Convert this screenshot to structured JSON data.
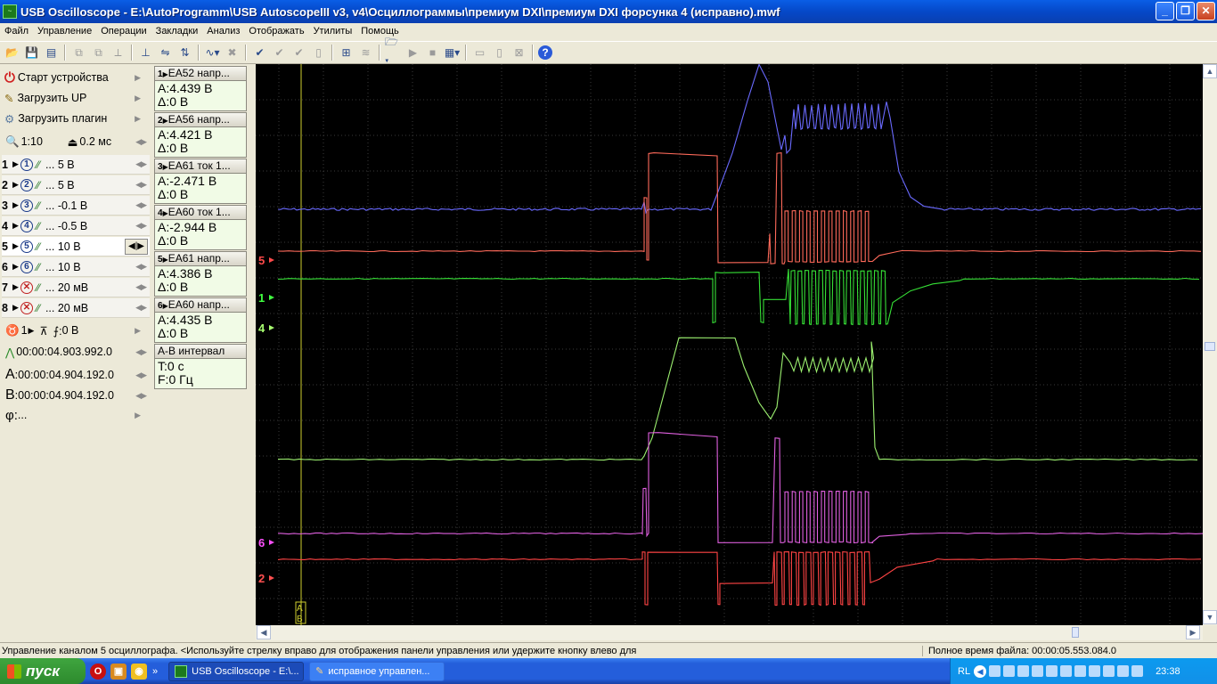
{
  "window": {
    "title": "USB Oscilloscope - E:\\AutoProgramm\\USB AutoscopeIII v3, v4\\Осциллограммы\\премиум DXI\\премиум DXI форсунка 4 (исправно).mwf"
  },
  "menu": [
    "Файл",
    "Управление",
    "Операции",
    "Закладки",
    "Анализ",
    "Отображать",
    "Утилиты",
    "Помощь"
  ],
  "toolbar_icons": [
    "open-icon",
    "save-icon",
    "print-icon",
    "copy-icon",
    "paste-icon",
    "measure-icon",
    "cursor-icon",
    "zoom-icon",
    "scale-icon",
    "filter-icon",
    "delete-icon",
    "check-icon",
    "check2-icon",
    "check3-icon",
    "page-icon",
    "grid-icon",
    "wave-icon",
    "folder-icon",
    "play-icon",
    "stop-icon",
    "display-icon",
    "chart-icon",
    "page2-icon",
    "close-icon",
    "help-icon"
  ],
  "left": {
    "start": "Старт устройства",
    "load_up": "Загрузить UP",
    "load_plugin": "Загрузить плагин",
    "zoom": "1:10",
    "timebase": "0.2 мс",
    "channels": [
      {
        "num": "1",
        "icon": "1",
        "volt": "... 5 В"
      },
      {
        "num": "2",
        "icon": "2",
        "volt": "... 5 В"
      },
      {
        "num": "3",
        "icon": "3",
        "volt": "... -0.1 В"
      },
      {
        "num": "4",
        "icon": "4",
        "volt": "... -0.5 В"
      },
      {
        "num": "5",
        "icon": "5",
        "volt": "... 10 В"
      },
      {
        "num": "6",
        "icon": "6",
        "volt": "... 10 В"
      },
      {
        "num": "7",
        "icon": "x",
        "volt": "... 20 мВ"
      },
      {
        "num": "8",
        "icon": "x",
        "volt": "... 20 мВ"
      }
    ],
    "trigger_channel": "1",
    "trigger_level": "0 В",
    "trigger_time": "00:00:04.903.992.0",
    "cursor_a": "00:00:04.904.192.0",
    "cursor_b": "00:00:04.904.192.0",
    "phi": "..."
  },
  "measure": [
    {
      "head": "EA52 напр...",
      "num": "1",
      "a": "A:4.439 В",
      "d": "Δ:0 В"
    },
    {
      "head": "EA56 напр...",
      "num": "2",
      "a": "A:4.421 В",
      "d": "Δ:0 В"
    },
    {
      "head": "EA61 ток 1...",
      "num": "3",
      "a": "A:-2.471 В",
      "d": "Δ:0 В"
    },
    {
      "head": "EA60 ток 1...",
      "num": "4",
      "a": "A:-2.944 В",
      "d": "Δ:0 В"
    },
    {
      "head": "EA61 напр...",
      "num": "5",
      "a": "A:4.386 В",
      "d": "Δ:0 В"
    },
    {
      "head": "EA60 напр...",
      "num": "6",
      "a": "A:4.435 В",
      "d": "Δ:0 В"
    },
    {
      "head": "A-B интервал",
      "num": "",
      "a": "T:0 с",
      "d": "F:0 Гц"
    }
  ],
  "scope": {
    "markers": [
      {
        "label": "5",
        "color": "#ff4a4a"
      },
      {
        "label": "1",
        "color": "#40ff40"
      },
      {
        "label": "4",
        "color": "#a8ff70"
      },
      {
        "label": "6",
        "color": "#ff50ff"
      },
      {
        "label": "2",
        "color": "#ff5050"
      }
    ],
    "cursor_labels": [
      "A",
      "B"
    ],
    "colors": {
      "ch1": "#36e036",
      "ch2": "#ff4444",
      "ch3": "#6a6aff",
      "ch4": "#9cf070",
      "ch5": "#ff6a5a",
      "ch6": "#e060e0",
      "grid": "#3a3a3a",
      "cursor": "#d0d030"
    }
  },
  "status": {
    "left": "Управление каналом 5 осциллографа. <Используйте стрелку вправо для отображения панели управления или удержите кнопку влево для",
    "right": "Полное время файла: 00:00:05.553.084.0"
  },
  "taskbar": {
    "start": "пуск",
    "tasks": [
      "USB Oscilloscope - E:\\...",
      "исправное управлен..."
    ],
    "lang": "RL",
    "clock": "23:38"
  }
}
